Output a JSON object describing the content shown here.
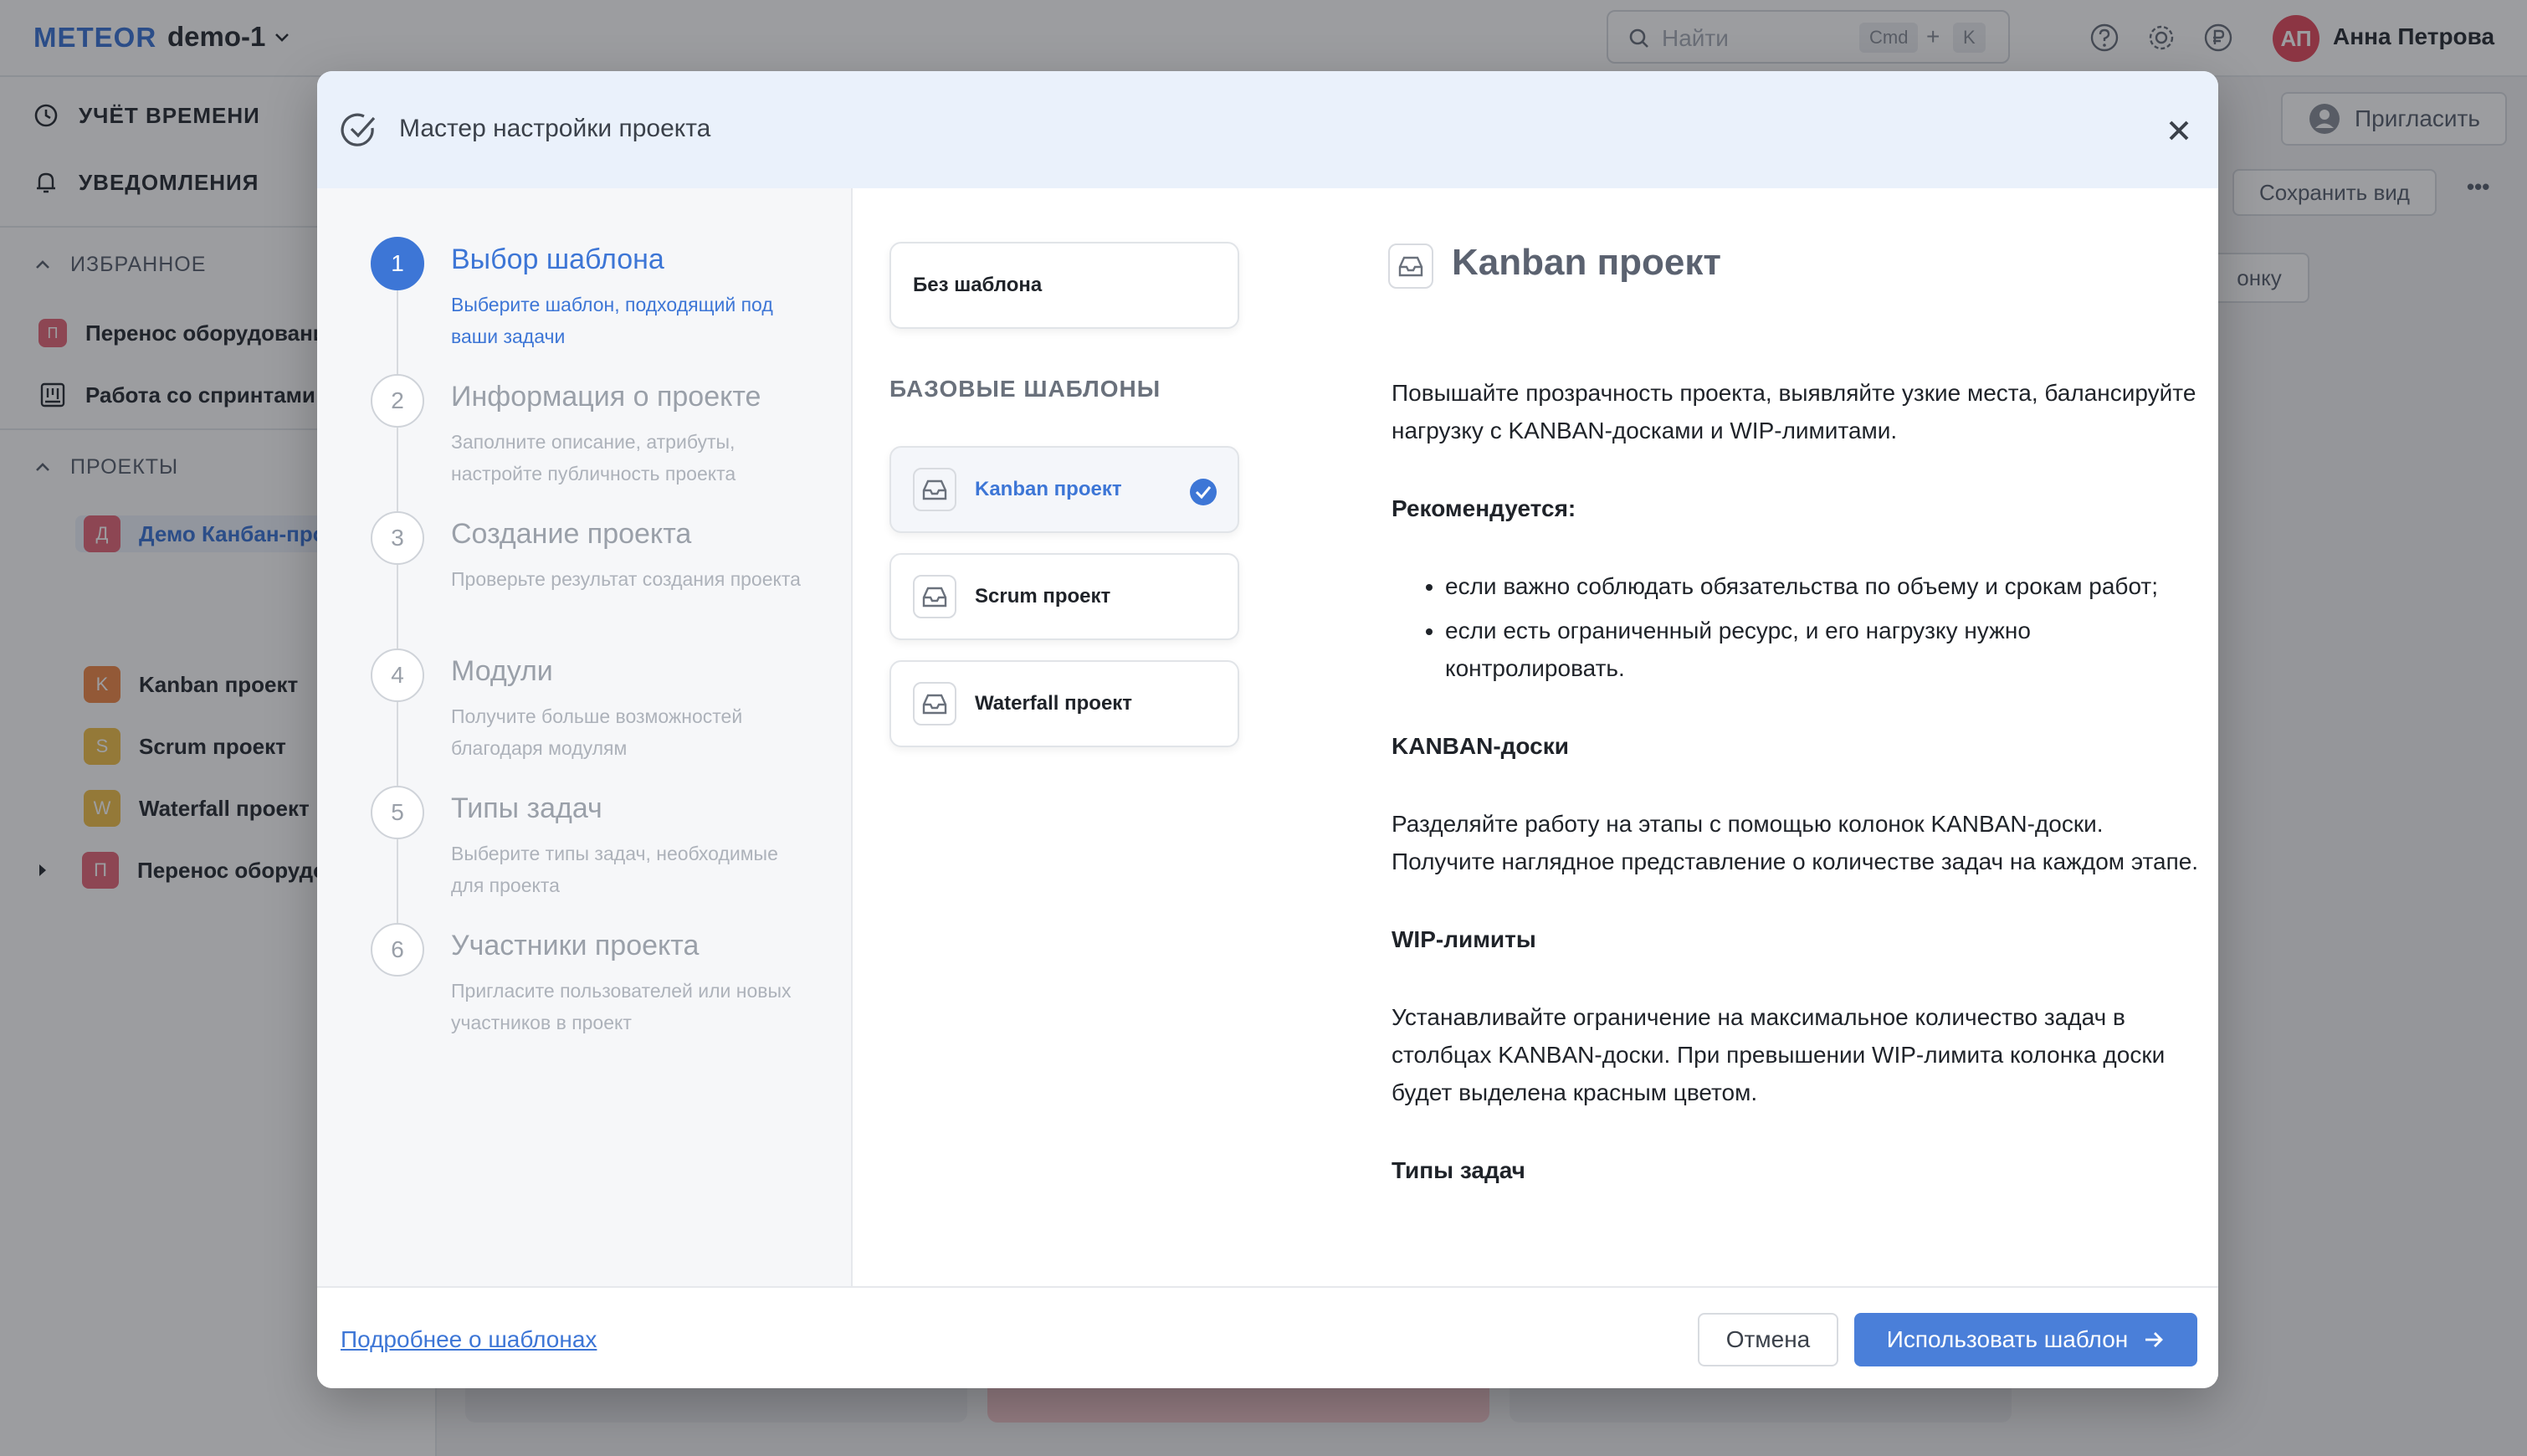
{
  "app": {
    "logo": "METEOR",
    "workspace": "demo-1",
    "search": {
      "placeholder": "Найти",
      "key1": "Cmd",
      "plus": "+",
      "key2": "K"
    },
    "user": {
      "initials": "АП",
      "name": "Анна Петрова"
    }
  },
  "sidebar": {
    "nav": [
      {
        "label": "УЧЁТ ВРЕМЕНИ",
        "icon": "clock-icon"
      },
      {
        "label": "УВЕДОМЛЕНИЯ",
        "icon": "bell-icon"
      }
    ],
    "favorites": {
      "title": "ИЗБРАННОЕ",
      "items": [
        {
          "badge": "П",
          "label": "Перенос оборудования",
          "color": "#e5697a"
        },
        {
          "badge": "",
          "label": "Работа со спринтами",
          "icon": "board-icon"
        }
      ]
    },
    "projects": {
      "title": "ПРОЕКТЫ",
      "items": [
        {
          "badge": "Д",
          "label": "Демо Канбан-проект",
          "color": "#e5697a"
        },
        {
          "badge": "K",
          "label": "Kanban проект",
          "color": "#f08a4b"
        },
        {
          "badge": "S",
          "label": "Scrum проект",
          "color": "#f1c24c"
        },
        {
          "badge": "W",
          "label": "Waterfall проект",
          "color": "#f1c24c"
        },
        {
          "badge": "П",
          "label": "Перенос оборудования",
          "color": "#e5697a"
        }
      ]
    }
  },
  "rightbar": {
    "invite": "Пригласить",
    "save_view": "Сохранить вид",
    "more": "•••",
    "partial": "онку"
  },
  "modal": {
    "title": "Мастер настройки проекта",
    "steps": [
      {
        "num": "1",
        "title": "Выбор шаблона",
        "desc": "Выберите шаблон, подходящий под ваши задачи"
      },
      {
        "num": "2",
        "title": "Информация о проекте",
        "desc": "Заполните описание, атрибуты, настройте публичность проекта"
      },
      {
        "num": "3",
        "title": "Создание проекта",
        "desc": "Проверьте результат создания проекта"
      },
      {
        "num": "4",
        "title": "Модули",
        "desc": "Получите больше возможностей благодаря модулям"
      },
      {
        "num": "5",
        "title": "Типы задач",
        "desc": "Выберите типы задач, необходимые для проекта"
      },
      {
        "num": "6",
        "title": "Участники проекта",
        "desc": "Пригласите пользователей или новых участников в проект"
      }
    ],
    "templates": {
      "none": "Без шаблона",
      "section": "БАЗОВЫЕ ШАБЛОНЫ",
      "items": [
        {
          "label": "Kanban проект",
          "selected": true
        },
        {
          "label": "Scrum проект",
          "selected": false
        },
        {
          "label": "Waterfall проект",
          "selected": false
        }
      ]
    },
    "detail": {
      "title": "Kanban проект",
      "intro": "Повышайте прозрачность проекта, выявляйте узкие места, балансируйте нагрузку с KANBAN-досками и WIP-лимитами.",
      "recommended_title": "Рекомендуется:",
      "recommended": [
        "если важно соблюдать обязательства по объему и срокам работ;",
        "если есть ограниченный ресурс, и его нагрузку нужно контролировать."
      ],
      "boards_title": "KANBAN-доски",
      "boards_text": "Разделяйте работу на этапы с помощью колонок KANBAN-доски. Получите наглядное представление о количестве задач на каждом этапе.",
      "wip_title": "WIP-лимиты",
      "wip_text": "Устанавливайте ограничение на максимальное количество задач в столбцах KANBAN-доски. При превышении WIP-лимита колонка доски будет выделена красным цветом.",
      "next_title": "Типы задач"
    },
    "footer": {
      "link": "Подробнее о шаблонах",
      "cancel": "Отмена",
      "use": "Использовать шаблон"
    }
  }
}
